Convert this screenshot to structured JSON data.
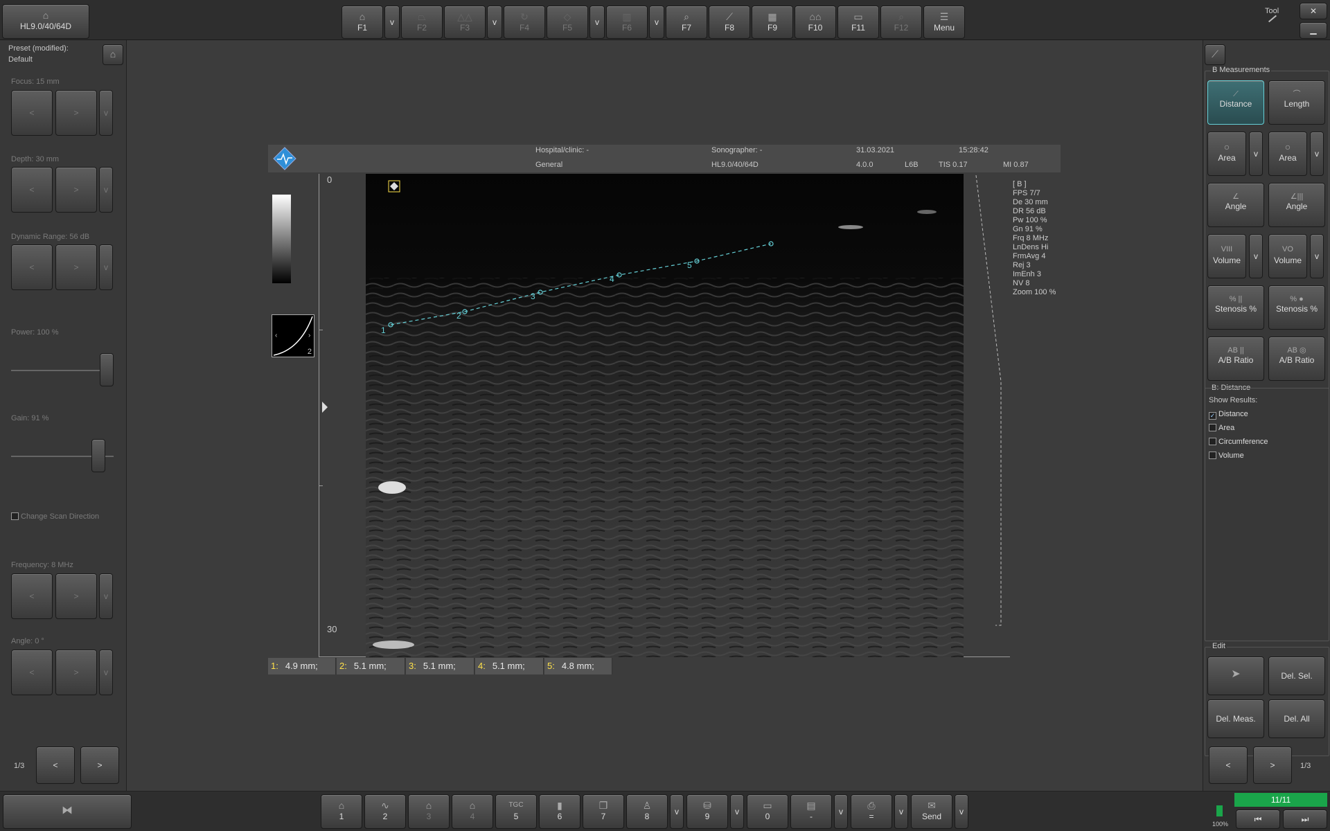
{
  "probe_button": "HL9.0/40/64D",
  "toolbar": [
    {
      "label": "F1",
      "icon": "probe-icon",
      "dim": false,
      "has_dropdown": true
    },
    {
      "label": "F2",
      "icon": "trapezoid-icon",
      "dim": true,
      "has_dropdown": false
    },
    {
      "label": "F3",
      "icon": "compound-icon",
      "dim": true,
      "has_dropdown": true
    },
    {
      "label": "F4",
      "icon": "rotate-icon",
      "dim": true,
      "has_dropdown": false
    },
    {
      "label": "F5",
      "icon": "steer-icon",
      "dim": true,
      "has_dropdown": true
    },
    {
      "label": "F6",
      "icon": "split-view-icon",
      "dim": true,
      "has_dropdown": true
    },
    {
      "label": "F7",
      "icon": "zoom-icon",
      "dim": false,
      "has_dropdown": false
    },
    {
      "label": "F8",
      "icon": "measure-icon",
      "dim": false,
      "has_dropdown": false
    },
    {
      "label": "F9",
      "icon": "calculator-icon",
      "dim": false,
      "has_dropdown": false
    },
    {
      "label": "F10",
      "icon": "layout-icon",
      "dim": false,
      "has_dropdown": false
    },
    {
      "label": "F11",
      "icon": "film-icon",
      "dim": false,
      "has_dropdown": false
    },
    {
      "label": "F12",
      "icon": "zoom-box-icon",
      "dim": true,
      "has_dropdown": false
    },
    {
      "label": "Menu",
      "icon": "menu-icon",
      "dim": false,
      "has_dropdown": false
    }
  ],
  "tool_label": "Tool",
  "window": {
    "close": "✕",
    "minimize": "▁"
  },
  "left": {
    "preset_title": "Preset (modified):",
    "preset_name": "Default",
    "focus_label": "Focus: 15 mm",
    "depth_label": "Depth: 30 mm",
    "dynamic_range_label": "Dynamic Range: 56 dB",
    "power_label": "Power: 100 %",
    "power_level": 1.0,
    "gain_label": "Gain: 91 %",
    "gain_level": 0.91,
    "change_scan_label": "Change Scan Direction",
    "frequency_label": "Frequency: 8 MHz",
    "angle_label": "Angle: 0 °",
    "page": "1/3",
    "prev": "<",
    "next": ">",
    "down": "v"
  },
  "header": {
    "hospital": "Hospital/clinic: -",
    "sonographer": "Sonographer: -",
    "date": "31.03.2021",
    "time": "15:28:42",
    "preset": "General",
    "probe": "HL9.0/40/64D",
    "version": "4.0.0",
    "probe_short": "L6B",
    "tis": "TIS 0.17",
    "mi": "MI 0.87"
  },
  "scale": {
    "top": "0",
    "bottom": "30",
    "tgc_number": "2"
  },
  "params": [
    "[ B ]",
    "FPS 7/7",
    "De 30 mm",
    "DR 56 dB",
    "Pw 100 %",
    "Gn 91 %",
    "Frq 8 MHz",
    "LnDens Hi",
    "FrmAvg 4",
    "Rej 3",
    "ImEnh 3",
    "NV 8",
    "Zoom 100 %"
  ],
  "points": [
    "1",
    "2",
    "3",
    "4",
    "5"
  ],
  "results": [
    {
      "n": "1:",
      "v": "4.9 mm;"
    },
    {
      "n": "2:",
      "v": "5.1 mm;"
    },
    {
      "n": "3:",
      "v": "5.1 mm;"
    },
    {
      "n": "4:",
      "v": "5.1 mm;"
    },
    {
      "n": "5:",
      "v": "4.8 mm;"
    }
  ],
  "right": {
    "section_title": "B Measurements",
    "buttons": [
      "Distance",
      "Length",
      "Area",
      "Area",
      "Angle",
      "Angle",
      "Volume",
      "Volume",
      "Stenosis %",
      "Stenosis %",
      "A/B Ratio",
      "A/B Ratio"
    ],
    "button_icons": [
      "VIII",
      "VO",
      "% ||",
      "% ●",
      "AB ||",
      "AB ◎"
    ],
    "distance_title": "B: Distance",
    "show_results": "Show Results:",
    "checks": [
      {
        "label": "Distance",
        "checked": true
      },
      {
        "label": "Area",
        "checked": false
      },
      {
        "label": "Circumference",
        "checked": false
      },
      {
        "label": "Volume",
        "checked": false
      }
    ],
    "edit_title": "Edit",
    "del_sel": "Del. Sel.",
    "del_meas": "Del. Meas.",
    "del_all": "Del. All",
    "page": "1/3",
    "prev": "<",
    "next": ">",
    "down": "v"
  },
  "bottom": {
    "buttons": [
      {
        "label": "1",
        "icon": "layout-1-icon",
        "dim": false
      },
      {
        "label": "2",
        "icon": "wave-icon",
        "dim": false
      },
      {
        "label": "3",
        "icon": "layout-3-icon",
        "dim": true
      },
      {
        "label": "4",
        "icon": "layout-4-icon",
        "dim": true
      },
      {
        "label": "5",
        "icon": "tgc-icon",
        "dim": false
      },
      {
        "label": "6",
        "icon": "grayscale-icon",
        "dim": false
      },
      {
        "label": "7",
        "icon": "stack-icon",
        "dim": false
      },
      {
        "label": "8",
        "icon": "body-marker-icon",
        "dim": false
      },
      {
        "label": "9",
        "icon": "save-icon",
        "dim": false
      },
      {
        "label": "0",
        "icon": "folder-icon",
        "dim": false
      },
      {
        "label": "-",
        "icon": "report-icon",
        "dim": false
      },
      {
        "label": "=",
        "icon": "print-icon",
        "dim": false
      },
      {
        "label": "Send",
        "icon": "send-icon",
        "dim": false
      }
    ],
    "battery": "100%",
    "frame_counter": "11/11",
    "down": "v"
  },
  "colors": {
    "accent": "#66d1d8",
    "counter_green": "#1aa54a",
    "number_yellow": "#ffe14a"
  }
}
